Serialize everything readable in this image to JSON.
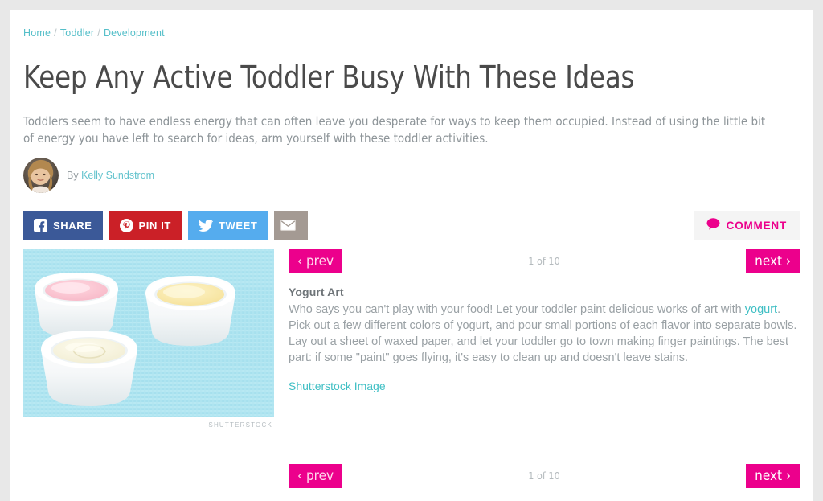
{
  "breadcrumb": {
    "items": [
      {
        "label": "Home"
      },
      {
        "label": "Toddler"
      },
      {
        "label": "Development"
      }
    ],
    "separator": "/"
  },
  "article": {
    "title": "Keep Any Active Toddler Busy With These Ideas",
    "deck": "Toddlers seem to have endless energy that can often leave you desperate for ways to keep them occupied. Instead of using the little bit of energy you have left to search for ideas, arm yourself with these toddler activities.",
    "byline_prefix": "By",
    "author": "Kelly Sundstrom"
  },
  "share": {
    "facebook_label": "SHARE",
    "pinterest_label": "PIN IT",
    "twitter_label": "TWEET",
    "email_label": "",
    "comment_label": "COMMENT",
    "colors": {
      "facebook": "#3b5998",
      "pinterest": "#cb2027",
      "twitter": "#55acee",
      "email": "#a49a93",
      "comment_accent": "#ec008c"
    }
  },
  "pager": {
    "prev_label": "‹ prev",
    "next_label": "next ›",
    "count_label": "1 of 10",
    "current": 1,
    "total": 10,
    "accent": "#ec008c"
  },
  "slide": {
    "heading": "Yogurt Art",
    "body_part_1": "Who says you can't play with your food! Let your toddler paint delicious works of art with ",
    "body_link": "yogurt",
    "body_part_2": ". Pick out a few different colors of yogurt, and pour small portions of each flavor into separate bowls. Lay out a sheet of waxed paper, and let your toddler go to town making finger paintings. The best part: if some \"paint\" goes flying, it's easy to clean up and doesn't leave stains.",
    "source_link_label": "Shutterstock Image",
    "photo_credit": "SHUTTERSTOCK",
    "photo_alt": "Three white ramekins filled with pink, yellow and cream colored yogurt on a light blue woven mat"
  }
}
